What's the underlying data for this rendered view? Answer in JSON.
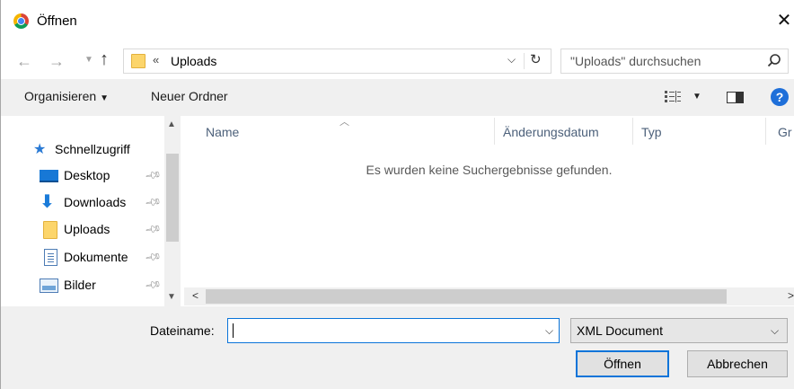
{
  "window": {
    "title": "Öffnen",
    "close_glyph": "✕"
  },
  "address": {
    "recent_glyph": "«",
    "current": "Uploads"
  },
  "search": {
    "placeholder": "\"Uploads\" durchsuchen"
  },
  "toolbar": {
    "organize": "Organisieren",
    "new_folder": "Neuer Ordner",
    "help": "?"
  },
  "nav": {
    "items": [
      {
        "label": "Schnellzugriff",
        "icon": "star-icon"
      },
      {
        "label": "Desktop",
        "icon": "desktop-icon",
        "pinned": true
      },
      {
        "label": "Downloads",
        "icon": "download-arrow-icon",
        "pinned": true
      },
      {
        "label": "Uploads",
        "icon": "folder-icon",
        "pinned": true
      },
      {
        "label": "Dokumente",
        "icon": "document-icon",
        "pinned": true
      },
      {
        "label": "Bilder",
        "icon": "pictures-icon",
        "pinned": true
      }
    ]
  },
  "filelist": {
    "columns": [
      "Name",
      "Änderungsdatum",
      "Typ",
      "Gr"
    ],
    "empty_message": "Es wurden keine Suchergebnisse gefunden."
  },
  "bottom": {
    "filename_label": "Dateiname:",
    "filename_value": "",
    "filetype_selected": "XML Document",
    "open_label": "Öffnen",
    "cancel_label": "Abbrechen"
  },
  "colors": {
    "accent": "#0a74d9",
    "toolbar_bg": "#f0f0f0",
    "folder": "#fcd56b",
    "help_blue": "#1e6fd9"
  }
}
